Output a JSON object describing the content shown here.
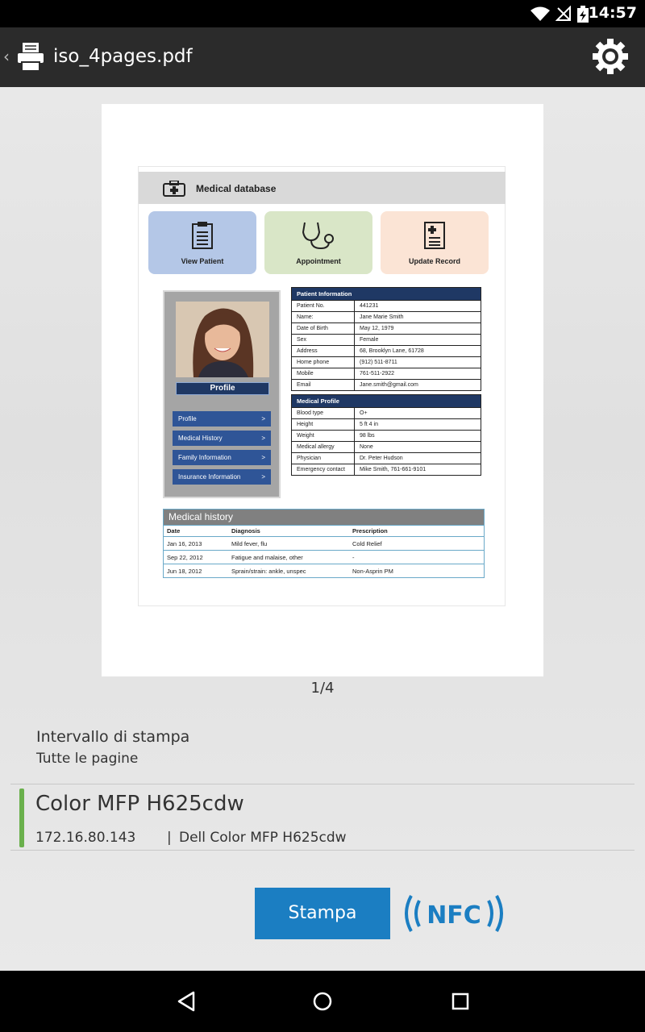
{
  "status_bar": {
    "time": "14:57"
  },
  "app_bar": {
    "title": "iso_4pages.pdf",
    "back_glyph": "‹"
  },
  "preview": {
    "page_counter": "1/4",
    "doc": {
      "title": "Medical database",
      "tiles": [
        {
          "label": "View Patient",
          "color": "#b4c7e7"
        },
        {
          "label": "Appointment",
          "color": "#d9e6c7"
        },
        {
          "label": "Update Record",
          "color": "#fbe4d5"
        }
      ],
      "profile": {
        "button": "Profile",
        "menu": [
          "Profile",
          "Medical History",
          "Family Information",
          "Insurance Information"
        ],
        "chevron": ">"
      },
      "patient_info": {
        "header": "Patient Information",
        "rows": [
          {
            "k": "Patient No.",
            "v": "441231"
          },
          {
            "k": "Name:",
            "v": "Jane Marie Smith"
          },
          {
            "k": "Date of Birth",
            "v": "May 12, 1979"
          },
          {
            "k": "Sex",
            "v": "Female"
          },
          {
            "k": "Address",
            "v": "68, Brooklyn Lane, 61728"
          },
          {
            "k": "Home phone",
            "v": "(912) 511-8711"
          },
          {
            "k": "Mobile",
            "v": "761-511-2922"
          },
          {
            "k": "Email",
            "v": "Jane.smith@gmail.com"
          }
        ]
      },
      "medical_profile": {
        "header": "Medical Profile",
        "rows": [
          {
            "k": "Blood type",
            "v": "O+"
          },
          {
            "k": "Height",
            "v": "5 ft 4 in"
          },
          {
            "k": "Weight",
            "v": "98 lbs"
          },
          {
            "k": "Medical allergy",
            "v": "None"
          },
          {
            "k": "Physician",
            "v": "Dr. Peter Hudson"
          },
          {
            "k": "Emergency contact",
            "v": "Mike Smith, 761-661-9101"
          }
        ]
      },
      "history": {
        "header": "Medical history",
        "columns": [
          "Date",
          "Diagnosis",
          "Prescription"
        ],
        "rows": [
          [
            "Jan 16, 2013",
            "Mild fever, flu",
            "Cold Relief"
          ],
          [
            "Sep 22, 2012",
            "Fatigue and malaise, other",
            "-"
          ],
          [
            "Jun 18, 2012",
            "Sprain/strain: ankle, unspec",
            "Non-Asprin PM"
          ]
        ]
      }
    }
  },
  "print_range": {
    "title": "Intervallo di stampa",
    "value": "Tutte le pagine"
  },
  "printer": {
    "name": "Color MFP H625cdw",
    "ip": "172.16.80.143",
    "separator": "|",
    "model": "Dell Color MFP H625cdw",
    "accent": "#6ab04c"
  },
  "actions": {
    "print_label": "Stampa",
    "nfc_label": "NFC",
    "accent": "#1b7ec2"
  },
  "icons": [
    "wifi-icon",
    "no-signal-icon",
    "battery-charging-icon",
    "printer-app-icon",
    "gear-icon",
    "first-aid-kit-icon",
    "clipboard-icon",
    "stethoscope-icon",
    "document-icon",
    "nfc-icon",
    "back-nav-icon",
    "home-nav-icon",
    "recents-nav-icon"
  ]
}
